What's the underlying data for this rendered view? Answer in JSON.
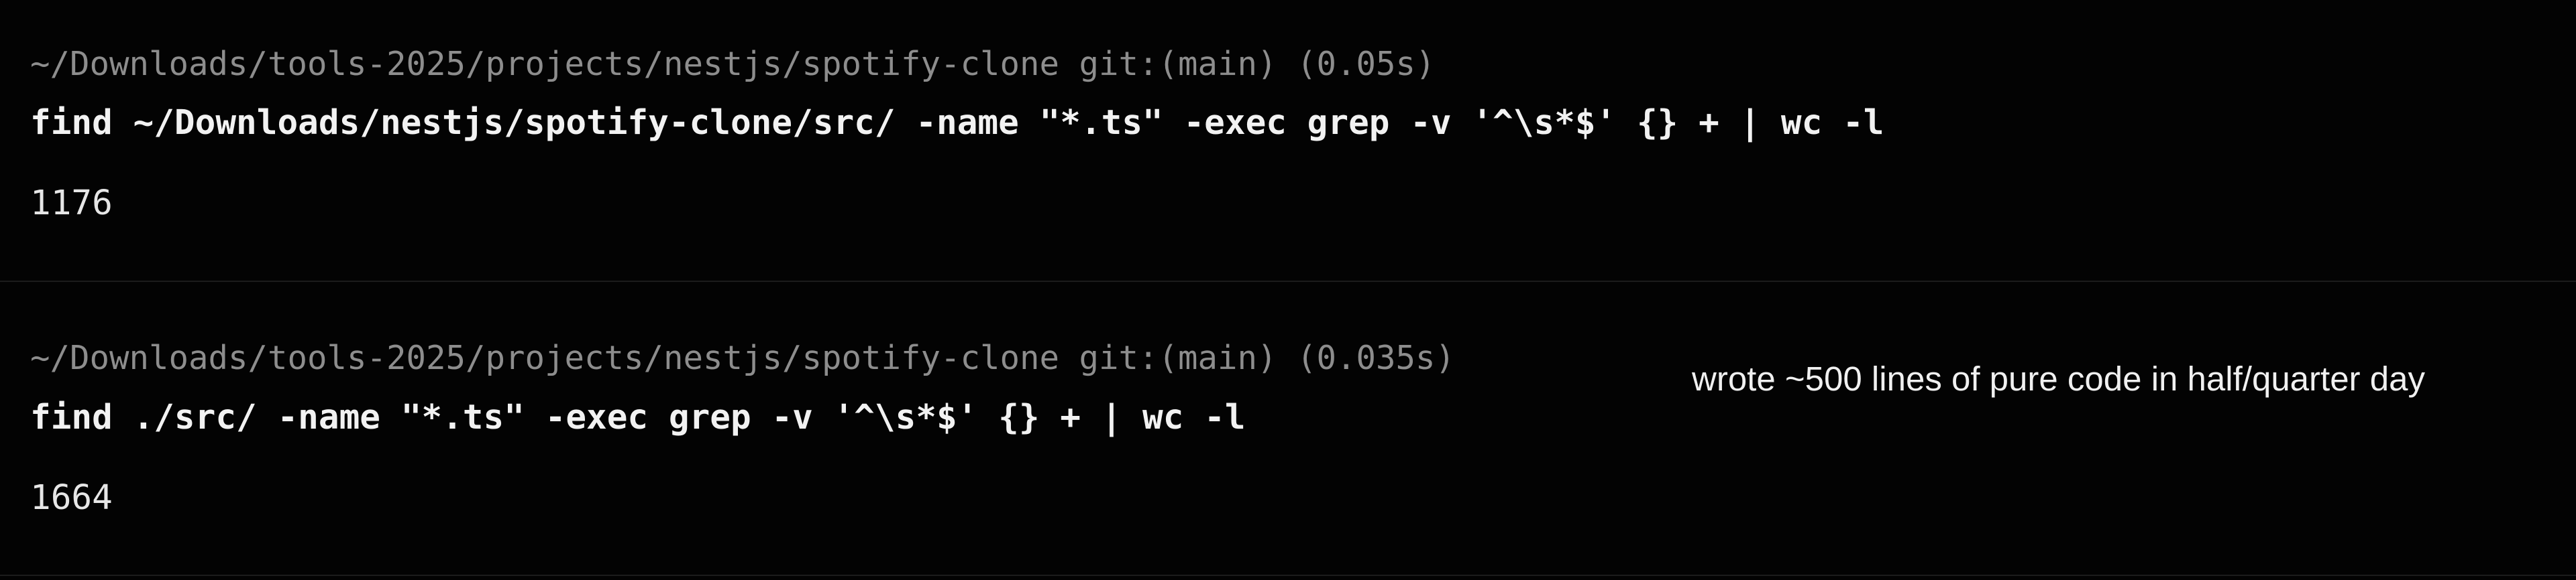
{
  "entries": [
    {
      "prompt": "~/Downloads/tools-2025/projects/nestjs/spotify-clone git:(main) (0.05s)",
      "command": "find ~/Downloads/nestjs/spotify-clone/src/ -name \"*.ts\" -exec grep -v '^\\s*$' {} + | wc -l",
      "output": "1176"
    },
    {
      "prompt": "~/Downloads/tools-2025/projects/nestjs/spotify-clone git:(main) (0.035s)",
      "command": "find ./src/ -name \"*.ts\" -exec grep -v '^\\s*$' {} + | wc -l",
      "output": "1664",
      "annotation": "wrote ~500 lines of pure code in half/quarter day"
    }
  ]
}
